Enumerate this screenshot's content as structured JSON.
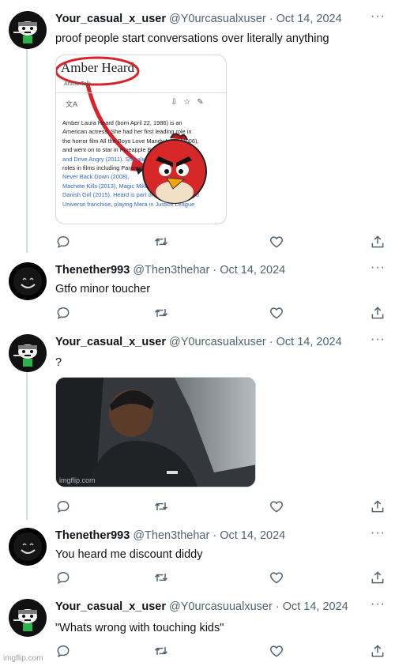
{
  "tweets": [
    {
      "name": "Your_casual_x_user",
      "handle": "@Y0urcasualxuser",
      "date": "Oct 14, 2024",
      "text": "proof people start conversations over literally anything",
      "avatar": "cartoon-character-avatar",
      "media": {
        "kind": "screenshot-wikipedia",
        "title": "Amber Heard",
        "tabs": [
          "Article",
          "Talk"
        ],
        "lines": [
          "Amber Laura Heard (born April 22, 1986) is an",
          "American actress. She had her first leading role in",
          "the horror film All the Boys Love Mandy Lane (2006),",
          "and went on to star in Pineapple Express (2008)",
          "and Drive Angry (2011). She also had supporting",
          "roles in films including Paranoia (2013),",
          "Never Back Down (2008),",
          "Machete Kills (2013), Magic Mike XXL and The",
          "Danish Girl (2015). Heard is part of the DC Extended",
          "Universe franchise, playing Mera in Justice League"
        ],
        "overlay": "angry-bird-red"
      }
    },
    {
      "name": "Thenether993",
      "handle": "@Then3thehar",
      "date": "Oct 14, 2024",
      "text": "Gtfo minor toucher",
      "avatar": "dark-smiling-face-avatar"
    },
    {
      "name": "Your_casual_x_user",
      "handle": "@Y0urcasualxuser",
      "date": "Oct 14, 2024",
      "text": "?",
      "avatar": "cartoon-character-avatar",
      "media": {
        "kind": "photo-man-in-car",
        "watermark": "imgflip.com"
      }
    },
    {
      "name": "Thenether993",
      "handle": "@Then3thehar",
      "date": "Oct 14, 2024",
      "text": "You heard me discount diddy",
      "avatar": "dark-smiling-face-avatar"
    },
    {
      "name": "Your_casual_x_user",
      "handle": "@Y0urcasuualxuser",
      "date": "Oct 14, 2024",
      "text": "\"Whats wrong with touching kids\"",
      "avatar": "cartoon-character-avatar"
    }
  ],
  "separator": "·",
  "more_label": "···",
  "actions": [
    "reply-icon",
    "retweet-icon",
    "like-icon",
    "share-icon"
  ],
  "colors": {
    "text": "#0f1419",
    "secondary": "#536471",
    "thread_line": "#cfd9de",
    "link": "#1d9bf0"
  },
  "page_watermark": "imgflip.com"
}
